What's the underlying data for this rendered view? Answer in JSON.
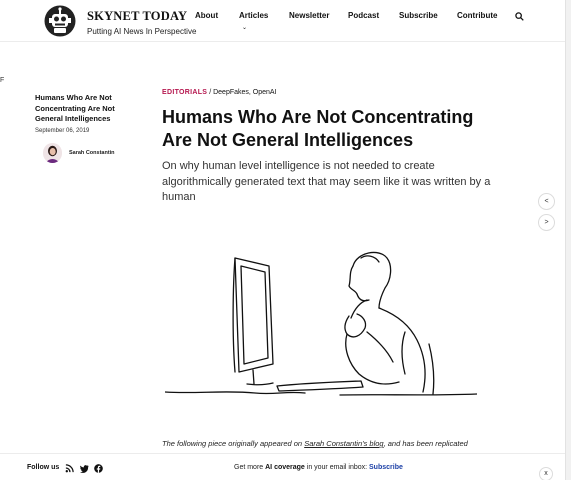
{
  "brand": {
    "title": "SKYNET TODAY",
    "tagline": "Putting AI News In Perspective",
    "logo_icon": "robot-logo-icon"
  },
  "nav": {
    "items": [
      "About",
      "Articles",
      "Newsletter",
      "Podcast",
      "Subscribe",
      "Contribute"
    ],
    "caret": "⌄",
    "search_icon": "search-icon"
  },
  "edge_text": "F",
  "sidebar": {
    "title": "Humans Who Are Not Concentrating Are Not General Intelligences",
    "date": "September 06, 2019",
    "author": "Sarah Constantin"
  },
  "article": {
    "category": "EDITORIALS",
    "tags": " / DeepFakes, OpenAI",
    "title": "Humans Who Are Not Concentrating Are Not General Intelligences",
    "subtitle": "On why human level intelligence is not needed to create algorithmically generated text that may seem like it was written by a human",
    "body_prefix": "The following piece originally appeared on ",
    "body_link": "Sarah Constantin's blog",
    "body_suffix": ", and has been replicated"
  },
  "arrows": {
    "prev": "<",
    "next": ">"
  },
  "footer": {
    "follow_label": "Follow us",
    "social_icons": [
      "rss-icon",
      "twitter-icon",
      "facebook-icon"
    ],
    "newsletter_prefix": "Get more ",
    "newsletter_bold": "AI coverage",
    "newsletter_mid": " in your email inbox: ",
    "newsletter_link": "Subscribe",
    "close": "x"
  },
  "colors": {
    "accent": "#b5174f",
    "link": "#1b3fa6",
    "text": "#111111"
  }
}
